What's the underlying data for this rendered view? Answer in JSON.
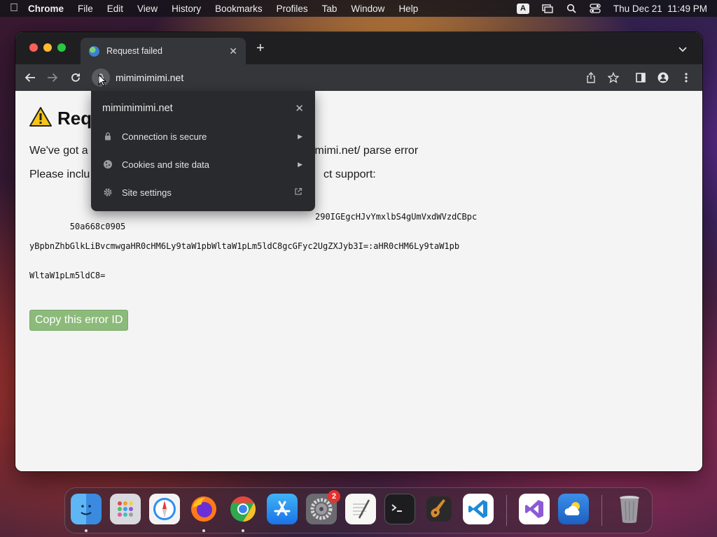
{
  "menubar": {
    "app_name": "Chrome",
    "items": [
      "File",
      "Edit",
      "View",
      "History",
      "Bookmarks",
      "Profiles",
      "Tab",
      "Window",
      "Help"
    ],
    "input_badge": "A",
    "clock": "Thu Dec 21  11:49 PM"
  },
  "tab": {
    "title": "Request failed"
  },
  "omnibox": {
    "url": "mimimimimi.net"
  },
  "popup": {
    "site": "mimimimimi.net",
    "rows": [
      {
        "label": "Connection is secure",
        "icon": "lock-icon"
      },
      {
        "label": "Cookies and site data",
        "icon": "cookie-icon"
      },
      {
        "label": "Site settings",
        "icon": "gear-icon"
      }
    ]
  },
  "page": {
    "title": "Req",
    "line1_start": "We've got a",
    "line1_end": "imimi.net/ parse error",
    "line2_start": "Please inclu",
    "line2_end": "ct support:",
    "error_line1_start": "50a668c0905",
    "error_line1_end": "290IGEgcHJvYmxlbS4gUmVxdWVzdCBpc",
    "error_line2": "yBpbnZhbGlkLiBvcmwgaHR0cHM6Ly9taW1pbWltaW1pLm5ldC8gcGFyc2UgZXJyb3I=:aHR0cHM6Ly9taW1pb",
    "error_line3": "WltaW1pLm5ldC8=",
    "copy_button": "Copy this error ID"
  },
  "dock": {
    "apps": [
      "Finder",
      "Launchpad",
      "Safari",
      "Firefox",
      "Chrome",
      "App Store",
      "System Settings",
      "TextEdit",
      "Terminal",
      "GarageBand",
      "Visual Studio Code",
      "Visual Studio",
      "Weather",
      "Trash"
    ],
    "settings_badge": "2"
  },
  "colors": {
    "accent_green": "#8cba7a",
    "warning_yellow": "#f5c518",
    "popup_bg": "#292a2d"
  }
}
